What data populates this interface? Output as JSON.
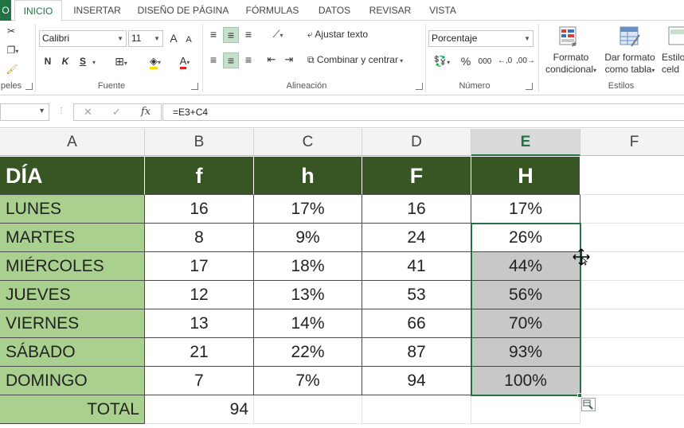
{
  "ribbon": {
    "tabs": [
      "INICIO",
      "INSERTAR",
      "DISEÑO DE PÁGINA",
      "FÓRMULAS",
      "DATOS",
      "REVISAR",
      "VISTA"
    ],
    "file_tab_label": "O",
    "groups": {
      "clipboard": "peles",
      "font": "Fuente",
      "alignment": "Alineación",
      "number": "Número",
      "styles": "Estilos"
    },
    "font": {
      "name": "Calibri",
      "size": "11",
      "grow": "A",
      "shrink": "A",
      "bold": "N",
      "italic": "K",
      "underline": "S",
      "font_color": "A"
    },
    "alignment": {
      "wrap_text": "Ajustar texto",
      "merge_center": "Combinar y centrar"
    },
    "number": {
      "format": "Porcentaje",
      "percent": "%",
      "thousands": "000"
    },
    "styles": {
      "conditional": [
        "Formato",
        "condicional"
      ],
      "as_table": [
        "Dar formato",
        "como tabla"
      ],
      "cell_styles": [
        "Estilos",
        "celd"
      ]
    }
  },
  "formula_bar": {
    "name_box": "",
    "cancel": "✕",
    "enter": "✓",
    "fx": "fx",
    "formula": "=E3+C4"
  },
  "sheet": {
    "columns": [
      "A",
      "B",
      "C",
      "D",
      "E",
      "F"
    ],
    "selected_column": "E",
    "header": [
      "DÍA",
      "f",
      "h",
      "F",
      "H"
    ],
    "rows": [
      [
        "LUNES",
        "16",
        "17%",
        "16",
        "17%"
      ],
      [
        "MARTES",
        "8",
        "9%",
        "24",
        "26%"
      ],
      [
        "MIÉRCOLES",
        "17",
        "18%",
        "41",
        "44%"
      ],
      [
        "JUEVES",
        "12",
        "13%",
        "53",
        "56%"
      ],
      [
        "VIERNES",
        "13",
        "14%",
        "66",
        "70%"
      ],
      [
        "SÁBADO",
        "21",
        "22%",
        "87",
        "93%"
      ],
      [
        "DOMINGO",
        "7",
        "7%",
        "94",
        "100%"
      ]
    ],
    "total_label": "TOTAL",
    "total_value": "94"
  }
}
